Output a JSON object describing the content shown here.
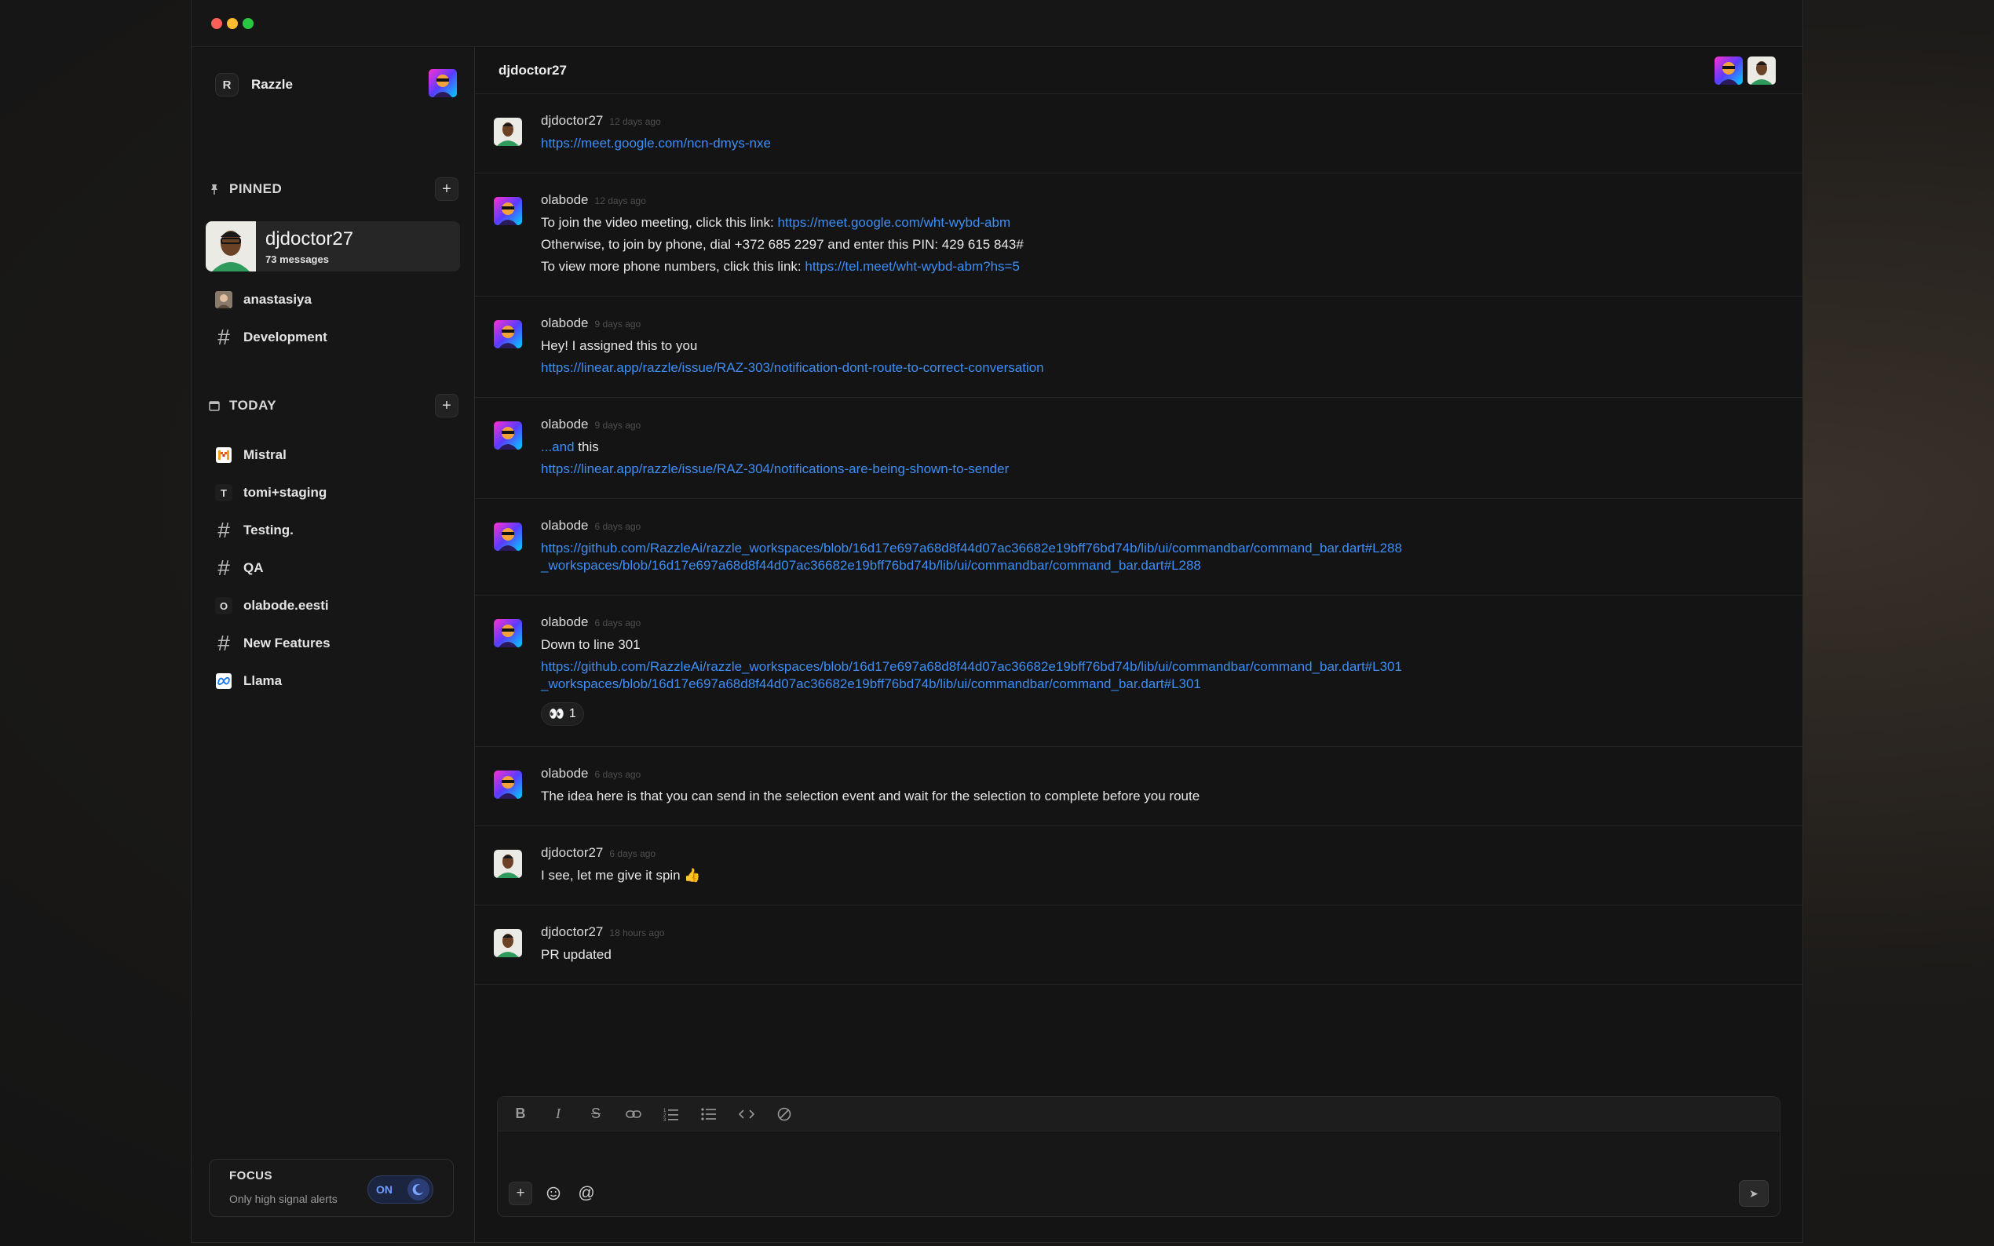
{
  "workspace": {
    "badge": "R",
    "name": "Razzle"
  },
  "pinned": {
    "label": "PINNED",
    "active": {
      "name": "djdoctor27",
      "subtitle": "73 messages"
    },
    "items": [
      {
        "label": "anastasiya",
        "icon": "user-avatar"
      },
      {
        "label": "Development",
        "icon": "hash-icon"
      }
    ]
  },
  "today": {
    "label": "TODAY",
    "items": [
      {
        "label": "Mistral",
        "icon": "mistral-logo"
      },
      {
        "label": "tomi+staging",
        "icon": "T"
      },
      {
        "label": "Testing.",
        "icon": "hash-icon"
      },
      {
        "label": "QA",
        "icon": "hash-icon"
      },
      {
        "label": "olabode.eesti",
        "icon": "O"
      },
      {
        "label": "New Features",
        "icon": "hash-icon"
      },
      {
        "label": "Llama",
        "icon": "meta-logo"
      }
    ]
  },
  "focus": {
    "title": "FOCUS",
    "subtitle": "Only high signal alerts",
    "toggle": "ON"
  },
  "header": {
    "title": "djdoctor27"
  },
  "messages": [
    {
      "user": "djdoctor27",
      "time": "12 days ago",
      "lines": [
        {
          "link": "https://meet.google.com/ncn-dmys-nxe"
        }
      ]
    },
    {
      "user": "olabode",
      "time": "12 days ago",
      "lines": [
        {
          "text": "To join the video meeting, click this link:",
          "link": "https://meet.google.com/wht-wybd-abm"
        },
        {
          "text": "Otherwise, to join by phone, dial +372 685 2297 and enter this PIN: 429 615 843#"
        },
        {
          "text": "To view more phone numbers, click this link:",
          "link": "https://tel.meet/wht-wybd-abm?hs=5"
        }
      ]
    },
    {
      "user": "olabode",
      "time": "9 days ago",
      "lines": [
        {
          "text": "Hey! I assigned this to you"
        },
        {
          "link": "https://linear.app/razzle/issue/RAZ-303/notification-dont-route-to-correct-conversation"
        }
      ]
    },
    {
      "user": "olabode",
      "time": "9 days ago",
      "lines": [
        {
          "link_prefix": "...and",
          "text": "this"
        },
        {
          "link": "https://linear.app/razzle/issue/RAZ-304/notifications-are-being-shown-to-sender"
        }
      ]
    },
    {
      "user": "olabode",
      "time": "6 days ago",
      "lines": [
        {
          "link": "https://github.com/RazzleAi/razzle_workspaces/blob/16d17e697a68d8f44d07ac36682e19bff76bd74b/lib/ui/commandbar/command_bar.dart#L288"
        },
        {
          "link": "_workspaces/blob/16d17e697a68d8f44d07ac36682e19bff76bd74b/lib/ui/commandbar/command_bar.dart#L288"
        }
      ]
    },
    {
      "user": "olabode",
      "time": "6 days ago",
      "lines": [
        {
          "text": "Down to line 301"
        },
        {
          "link": "https://github.com/RazzleAi/razzle_workspaces/blob/16d17e697a68d8f44d07ac36682e19bff76bd74b/lib/ui/commandbar/command_bar.dart#L301"
        },
        {
          "link": "_workspaces/blob/16d17e697a68d8f44d07ac36682e19bff76bd74b/lib/ui/commandbar/command_bar.dart#L301"
        }
      ],
      "reaction": {
        "emoji": "👀",
        "count": "1"
      }
    },
    {
      "user": "olabode",
      "time": "6 days ago",
      "lines": [
        {
          "text": "The idea here is that you can send in the selection event and wait for the selection to complete before you route"
        }
      ]
    },
    {
      "user": "djdoctor27",
      "time": "6 days ago",
      "lines": [
        {
          "text": "I see, let me give it spin 👍"
        }
      ]
    },
    {
      "user": "djdoctor27",
      "time": "18 hours ago",
      "lines": [
        {
          "text": "PR updated"
        }
      ]
    }
  ],
  "composer": {
    "format_buttons": [
      "bold-icon",
      "italic-icon",
      "strikethrough-icon",
      "link-icon",
      "ordered-list-icon",
      "bullet-list-icon",
      "code-icon",
      "clear-format-icon"
    ],
    "send_icon": "send-icon"
  }
}
